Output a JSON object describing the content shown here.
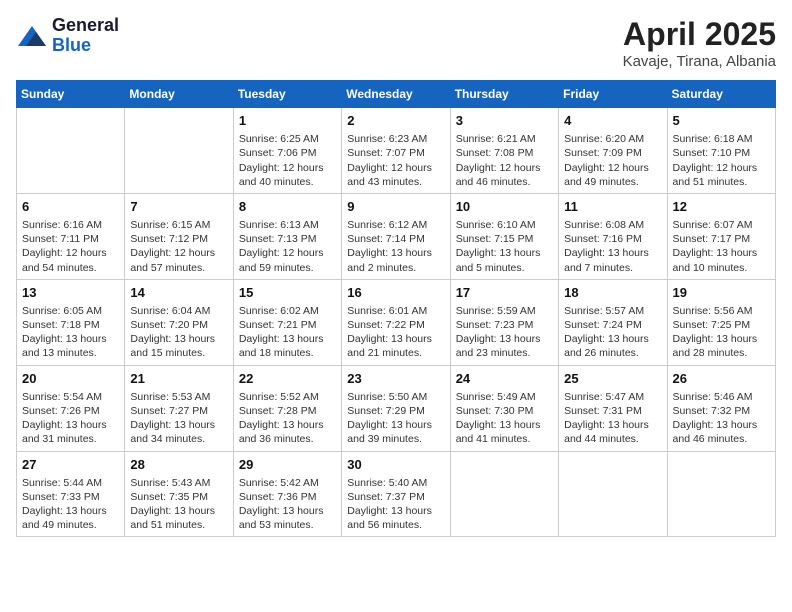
{
  "header": {
    "logo_general": "General",
    "logo_blue": "Blue",
    "title": "April 2025",
    "location": "Kavaje, Tirana, Albania"
  },
  "weekdays": [
    "Sunday",
    "Monday",
    "Tuesday",
    "Wednesday",
    "Thursday",
    "Friday",
    "Saturday"
  ],
  "weeks": [
    [
      {
        "day": "",
        "info": ""
      },
      {
        "day": "",
        "info": ""
      },
      {
        "day": "1",
        "sunrise": "Sunrise: 6:25 AM",
        "sunset": "Sunset: 7:06 PM",
        "daylight": "Daylight: 12 hours and 40 minutes."
      },
      {
        "day": "2",
        "sunrise": "Sunrise: 6:23 AM",
        "sunset": "Sunset: 7:07 PM",
        "daylight": "Daylight: 12 hours and 43 minutes."
      },
      {
        "day": "3",
        "sunrise": "Sunrise: 6:21 AM",
        "sunset": "Sunset: 7:08 PM",
        "daylight": "Daylight: 12 hours and 46 minutes."
      },
      {
        "day": "4",
        "sunrise": "Sunrise: 6:20 AM",
        "sunset": "Sunset: 7:09 PM",
        "daylight": "Daylight: 12 hours and 49 minutes."
      },
      {
        "day": "5",
        "sunrise": "Sunrise: 6:18 AM",
        "sunset": "Sunset: 7:10 PM",
        "daylight": "Daylight: 12 hours and 51 minutes."
      }
    ],
    [
      {
        "day": "6",
        "sunrise": "Sunrise: 6:16 AM",
        "sunset": "Sunset: 7:11 PM",
        "daylight": "Daylight: 12 hours and 54 minutes."
      },
      {
        "day": "7",
        "sunrise": "Sunrise: 6:15 AM",
        "sunset": "Sunset: 7:12 PM",
        "daylight": "Daylight: 12 hours and 57 minutes."
      },
      {
        "day": "8",
        "sunrise": "Sunrise: 6:13 AM",
        "sunset": "Sunset: 7:13 PM",
        "daylight": "Daylight: 12 hours and 59 minutes."
      },
      {
        "day": "9",
        "sunrise": "Sunrise: 6:12 AM",
        "sunset": "Sunset: 7:14 PM",
        "daylight": "Daylight: 13 hours and 2 minutes."
      },
      {
        "day": "10",
        "sunrise": "Sunrise: 6:10 AM",
        "sunset": "Sunset: 7:15 PM",
        "daylight": "Daylight: 13 hours and 5 minutes."
      },
      {
        "day": "11",
        "sunrise": "Sunrise: 6:08 AM",
        "sunset": "Sunset: 7:16 PM",
        "daylight": "Daylight: 13 hours and 7 minutes."
      },
      {
        "day": "12",
        "sunrise": "Sunrise: 6:07 AM",
        "sunset": "Sunset: 7:17 PM",
        "daylight": "Daylight: 13 hours and 10 minutes."
      }
    ],
    [
      {
        "day": "13",
        "sunrise": "Sunrise: 6:05 AM",
        "sunset": "Sunset: 7:18 PM",
        "daylight": "Daylight: 13 hours and 13 minutes."
      },
      {
        "day": "14",
        "sunrise": "Sunrise: 6:04 AM",
        "sunset": "Sunset: 7:20 PM",
        "daylight": "Daylight: 13 hours and 15 minutes."
      },
      {
        "day": "15",
        "sunrise": "Sunrise: 6:02 AM",
        "sunset": "Sunset: 7:21 PM",
        "daylight": "Daylight: 13 hours and 18 minutes."
      },
      {
        "day": "16",
        "sunrise": "Sunrise: 6:01 AM",
        "sunset": "Sunset: 7:22 PM",
        "daylight": "Daylight: 13 hours and 21 minutes."
      },
      {
        "day": "17",
        "sunrise": "Sunrise: 5:59 AM",
        "sunset": "Sunset: 7:23 PM",
        "daylight": "Daylight: 13 hours and 23 minutes."
      },
      {
        "day": "18",
        "sunrise": "Sunrise: 5:57 AM",
        "sunset": "Sunset: 7:24 PM",
        "daylight": "Daylight: 13 hours and 26 minutes."
      },
      {
        "day": "19",
        "sunrise": "Sunrise: 5:56 AM",
        "sunset": "Sunset: 7:25 PM",
        "daylight": "Daylight: 13 hours and 28 minutes."
      }
    ],
    [
      {
        "day": "20",
        "sunrise": "Sunrise: 5:54 AM",
        "sunset": "Sunset: 7:26 PM",
        "daylight": "Daylight: 13 hours and 31 minutes."
      },
      {
        "day": "21",
        "sunrise": "Sunrise: 5:53 AM",
        "sunset": "Sunset: 7:27 PM",
        "daylight": "Daylight: 13 hours and 34 minutes."
      },
      {
        "day": "22",
        "sunrise": "Sunrise: 5:52 AM",
        "sunset": "Sunset: 7:28 PM",
        "daylight": "Daylight: 13 hours and 36 minutes."
      },
      {
        "day": "23",
        "sunrise": "Sunrise: 5:50 AM",
        "sunset": "Sunset: 7:29 PM",
        "daylight": "Daylight: 13 hours and 39 minutes."
      },
      {
        "day": "24",
        "sunrise": "Sunrise: 5:49 AM",
        "sunset": "Sunset: 7:30 PM",
        "daylight": "Daylight: 13 hours and 41 minutes."
      },
      {
        "day": "25",
        "sunrise": "Sunrise: 5:47 AM",
        "sunset": "Sunset: 7:31 PM",
        "daylight": "Daylight: 13 hours and 44 minutes."
      },
      {
        "day": "26",
        "sunrise": "Sunrise: 5:46 AM",
        "sunset": "Sunset: 7:32 PM",
        "daylight": "Daylight: 13 hours and 46 minutes."
      }
    ],
    [
      {
        "day": "27",
        "sunrise": "Sunrise: 5:44 AM",
        "sunset": "Sunset: 7:33 PM",
        "daylight": "Daylight: 13 hours and 49 minutes."
      },
      {
        "day": "28",
        "sunrise": "Sunrise: 5:43 AM",
        "sunset": "Sunset: 7:35 PM",
        "daylight": "Daylight: 13 hours and 51 minutes."
      },
      {
        "day": "29",
        "sunrise": "Sunrise: 5:42 AM",
        "sunset": "Sunset: 7:36 PM",
        "daylight": "Daylight: 13 hours and 53 minutes."
      },
      {
        "day": "30",
        "sunrise": "Sunrise: 5:40 AM",
        "sunset": "Sunset: 7:37 PM",
        "daylight": "Daylight: 13 hours and 56 minutes."
      },
      {
        "day": "",
        "info": ""
      },
      {
        "day": "",
        "info": ""
      },
      {
        "day": "",
        "info": ""
      }
    ]
  ]
}
